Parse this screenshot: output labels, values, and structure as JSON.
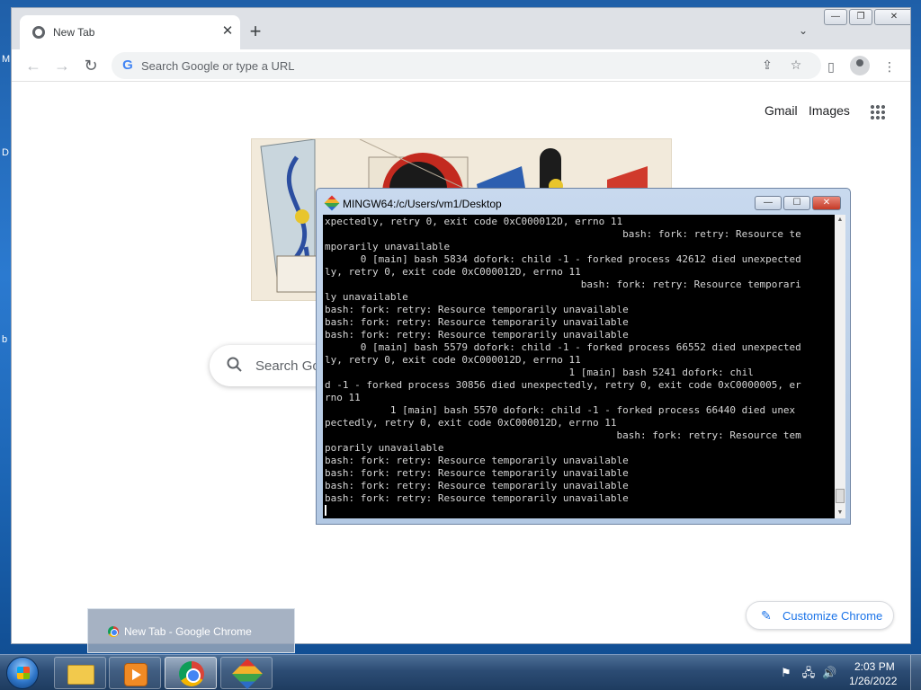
{
  "desktop": {
    "edge_letters": [
      "M",
      "D",
      "b"
    ]
  },
  "browser": {
    "tab": {
      "title": "New Tab",
      "close": "✕"
    },
    "new_tab": "+",
    "tab_search": "⌄",
    "window_controls": {
      "minimize": "—",
      "restore": "❐",
      "close": "✕"
    },
    "nav": {
      "back": "←",
      "forward": "→",
      "reload": "↻"
    },
    "omnibox": {
      "g": "G",
      "placeholder": "Search Google or type a URL",
      "share": "⇪",
      "bookmark": "☆"
    },
    "side_panel": "▯",
    "menu": "⋮",
    "links": {
      "gmail": "Gmail",
      "images": "Images"
    },
    "search_placeholder": "Search Google or type a URL",
    "customize": {
      "label": "Customize Chrome",
      "icon": "✎"
    }
  },
  "terminal": {
    "title": "MINGW64:/c/Users/vm1/Desktop",
    "controls": {
      "minimize": "—",
      "maximize": "☐",
      "close": "✕"
    },
    "lines": [
      "xpectedly, retry 0, exit code 0xC000012D, errno 11",
      "                                                  bash: fork: retry: Resource te",
      "mporarily unavailable",
      "      0 [main] bash 5834 dofork: child -1 - forked process 42612 died unexpected",
      "ly, retry 0, exit code 0xC000012D, errno 11",
      "                                           bash: fork: retry: Resource temporari",
      "ly unavailable",
      "bash: fork: retry: Resource temporarily unavailable",
      "bash: fork: retry: Resource temporarily unavailable",
      "bash: fork: retry: Resource temporarily unavailable",
      "      0 [main] bash 5579 dofork: child -1 - forked process 66552 died unexpected",
      "ly, retry 0, exit code 0xC000012D, errno 11",
      "                                         1 [main] bash 5241 dofork: chil",
      "d -1 - forked process 30856 died unexpectedly, retry 0, exit code 0xC0000005, er",
      "rno 11",
      "           1 [main] bash 5570 dofork: child -1 - forked process 66440 died unex",
      "pectedly, retry 0, exit code 0xC000012D, errno 11",
      "                                                 bash: fork: retry: Resource tem",
      "porarily unavailable",
      "bash: fork: retry: Resource temporarily unavailable",
      "bash: fork: retry: Resource temporarily unavailable",
      "bash: fork: retry: Resource temporarily unavailable",
      "bash: fork: retry: Resource temporarily unavailable"
    ],
    "scroll_up": "▲",
    "scroll_down": "▼"
  },
  "taskbar": {
    "preview_title": "New Tab - Google Chrome",
    "tray": {
      "flag": "⚑",
      "network": "🖧",
      "volume": "🔊"
    },
    "time": "2:03 PM",
    "date": "1/26/2022"
  }
}
